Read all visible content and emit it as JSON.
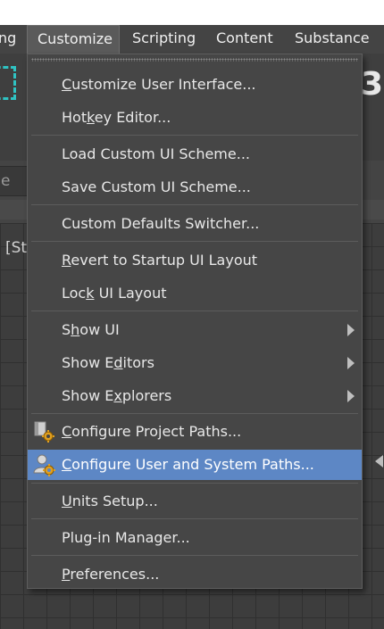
{
  "menubar": {
    "items": [
      {
        "label": "ng"
      },
      {
        "label": "Customize"
      },
      {
        "label": "Scripting"
      },
      {
        "label": "Content"
      },
      {
        "label": "Substance"
      }
    ]
  },
  "background": {
    "right_glyph": "3",
    "field_text": "e",
    "viewport_label": "[St"
  },
  "menu": {
    "items": [
      {
        "pre": "",
        "u": "C",
        "post": "ustomize User Interface..."
      },
      {
        "pre": "Hot",
        "u": "k",
        "post": "ey Editor..."
      },
      {
        "pre": "Load Custom UI Scheme...",
        "u": "",
        "post": ""
      },
      {
        "pre": "Save Custom UI Scheme...",
        "u": "",
        "post": ""
      },
      {
        "pre": "Custom Defaults Switcher...",
        "u": "",
        "post": ""
      },
      {
        "pre": "",
        "u": "R",
        "post": "evert to Startup UI Layout"
      },
      {
        "pre": "Loc",
        "u": "k",
        "post": " UI Layout"
      },
      {
        "pre": "S",
        "u": "h",
        "post": "ow UI",
        "submenu": true
      },
      {
        "pre": "Show E",
        "u": "d",
        "post": "itors",
        "submenu": true
      },
      {
        "pre": "Show E",
        "u": "x",
        "post": "plorers",
        "submenu": true
      },
      {
        "pre": "",
        "u": "C",
        "post": "onfigure Project Paths...",
        "icon": "project-paths-icon"
      },
      {
        "pre": "",
        "u": "C",
        "post": "onfigure User and System Paths...",
        "icon": "user-paths-icon",
        "highlighted": true
      },
      {
        "pre": "",
        "u": "U",
        "post": "nits Setup..."
      },
      {
        "pre": "Plug-in Manager...",
        "u": "",
        "post": ""
      },
      {
        "pre": "",
        "u": "P",
        "post": "references..."
      }
    ]
  },
  "colors": {
    "highlight": "#5d87c5",
    "accent_cyan": "#2fc3c3",
    "gear": "#e0a020"
  }
}
